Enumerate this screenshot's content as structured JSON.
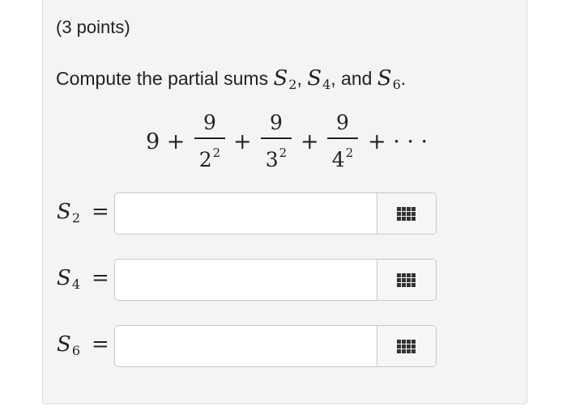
{
  "header": {
    "points": "(3 points)"
  },
  "question": {
    "prefix": "Compute the partial sums",
    "s2": "S",
    "s2_sub": "2",
    "s4": "S",
    "s4_sub": "4",
    "s6": "S",
    "s6_sub": "6",
    "sep1": ",",
    "sep2": ", and",
    "end": "."
  },
  "series": {
    "first": "9 +",
    "terms": [
      {
        "num": "9",
        "base": "2",
        "exp": "2"
      },
      {
        "num": "9",
        "base": "3",
        "exp": "2"
      },
      {
        "num": "9",
        "base": "4",
        "exp": "2"
      }
    ],
    "plus": "+",
    "tail": "+ · · ·"
  },
  "answers": [
    {
      "var": "S",
      "sub": "2",
      "eq": "=",
      "value": "",
      "keypad_icon": "keypad-grid-icon"
    },
    {
      "var": "S",
      "sub": "4",
      "eq": "=",
      "value": "",
      "keypad_icon": "keypad-grid-icon"
    },
    {
      "var": "S",
      "sub": "6",
      "eq": "=",
      "value": "",
      "keypad_icon": "keypad-grid-icon"
    }
  ]
}
